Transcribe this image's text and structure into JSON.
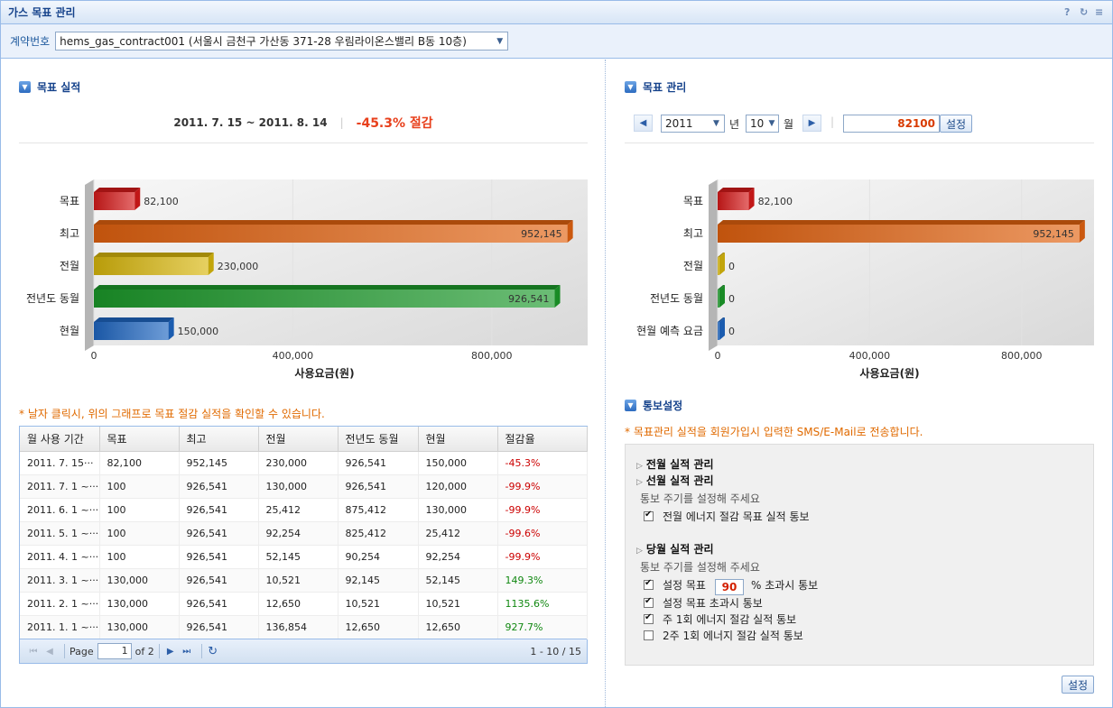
{
  "window": {
    "title": "가스 목표 관리",
    "tools": [
      "help-icon",
      "refresh-icon",
      "menu-icon"
    ]
  },
  "contract": {
    "label": "계약번호",
    "selected": "hems_gas_contract001 (서울시 금천구 가산동 371-28 우림라이온스밸리 B동 10층)"
  },
  "left": {
    "section_title": "목표 실적",
    "period": "2011. 7. 15 ~ 2011. 8. 14",
    "saving": "-45.3% 절감",
    "note": "* 날자 클릭시, 위의 그래프로 목표 절감 실적을 확인할 수 있습니다."
  },
  "right": {
    "section_title": "목표 관리",
    "year": "2011",
    "year_unit": "년",
    "month": "10",
    "month_unit": "월",
    "target_value": "82100",
    "set_button": "설정"
  },
  "chart_data": [
    {
      "type": "bar",
      "orientation": "horizontal",
      "categories": [
        "목표",
        "최고",
        "전월",
        "전년도 동월",
        "현월"
      ],
      "values": [
        82100,
        952145,
        230000,
        926541,
        150000
      ],
      "value_labels": [
        "82,100",
        "952,145",
        "230,000",
        "926,541",
        "150,000"
      ],
      "colors": [
        "#d61a1a",
        "#e2620f",
        "#d8b70c",
        "#1c9a2a",
        "#1e66c2"
      ],
      "xlabel": "사용요금(원)",
      "xticks": [
        "0",
        "400,000",
        "800,000"
      ],
      "tick_values": [
        0,
        400000,
        800000
      ],
      "xlim": [
        0,
        1000000
      ]
    },
    {
      "type": "bar",
      "orientation": "horizontal",
      "categories": [
        "목표",
        "최고",
        "전월",
        "전년도 동월",
        "현월 예측 요금"
      ],
      "values": [
        82100,
        952145,
        0,
        0,
        0
      ],
      "value_labels": [
        "82,100",
        "952,145",
        "0",
        "0",
        "0"
      ],
      "colors": [
        "#d61a1a",
        "#e2620f",
        "#d8b70c",
        "#1c9a2a",
        "#1e66c2"
      ],
      "xlabel": "사용요금(원)",
      "xticks": [
        "0",
        "400,000",
        "800,000"
      ],
      "tick_values": [
        0,
        400000,
        800000
      ],
      "xlim": [
        0,
        1000000
      ]
    }
  ],
  "table": {
    "columns": [
      "월 사용 기간",
      "목표",
      "최고",
      "전월",
      "전년도 동월",
      "현월",
      "절감율"
    ],
    "rows": [
      [
        "2011. 7. 15···",
        "82,100",
        "952,145",
        "230,000",
        "926,541",
        "150,000",
        "-45.3%"
      ],
      [
        "2011. 7. 1 ~···",
        "100",
        "926,541",
        "130,000",
        "926,541",
        "120,000",
        "-99.9%"
      ],
      [
        "2011. 6. 1 ~···",
        "100",
        "926,541",
        "25,412",
        "875,412",
        "130,000",
        "-99.9%"
      ],
      [
        "2011. 5. 1 ~···",
        "100",
        "926,541",
        "92,254",
        "825,412",
        "25,412",
        "-99.6%"
      ],
      [
        "2011. 4. 1 ~···",
        "100",
        "926,541",
        "52,145",
        "90,254",
        "92,254",
        "-99.9%"
      ],
      [
        "2011. 3. 1 ~···",
        "130,000",
        "926,541",
        "10,521",
        "92,145",
        "52,145",
        "149.3%"
      ],
      [
        "2011. 2. 1 ~···",
        "130,000",
        "926,541",
        "12,650",
        "10,521",
        "10,521",
        "1135.6%"
      ],
      [
        "2011. 1. 1 ~···",
        "130,000",
        "926,541",
        "136,854",
        "12,650",
        "12,650",
        "927.7%"
      ]
    ],
    "pager": {
      "page_label": "Page",
      "page": "1",
      "of": "of 2",
      "range": "1 - 10 / 15"
    }
  },
  "notify": {
    "section_title": "통보설정",
    "note": "* 목표관리 실적을 회원가입시 입력한 SMS/E-Mail로 전송합니다.",
    "prev_head": "전월 실적 관리",
    "prev2_head": "선월 실적 관리",
    "prev_sub": "통보 주기를 설정해 주세요",
    "prev_cb1": "전월 에너지 절감 목표 실적 통보",
    "cur_head": "당월 실적 관리",
    "cur_sub": "통보 주기를 설정해 주세요",
    "cur_cb1_a": "설정 목표",
    "cur_cb1_pct": "90",
    "cur_cb1_b": "% 초과시 통보",
    "cur_cb2": "설정 목표 초과시 통보",
    "cur_cb3": "주 1회 에너지 절감 실적 통보",
    "cur_cb4": "2주 1회 에너지 절감 실적 통보",
    "checks": [
      true,
      true,
      true,
      true,
      false
    ],
    "save_button": "설정"
  }
}
